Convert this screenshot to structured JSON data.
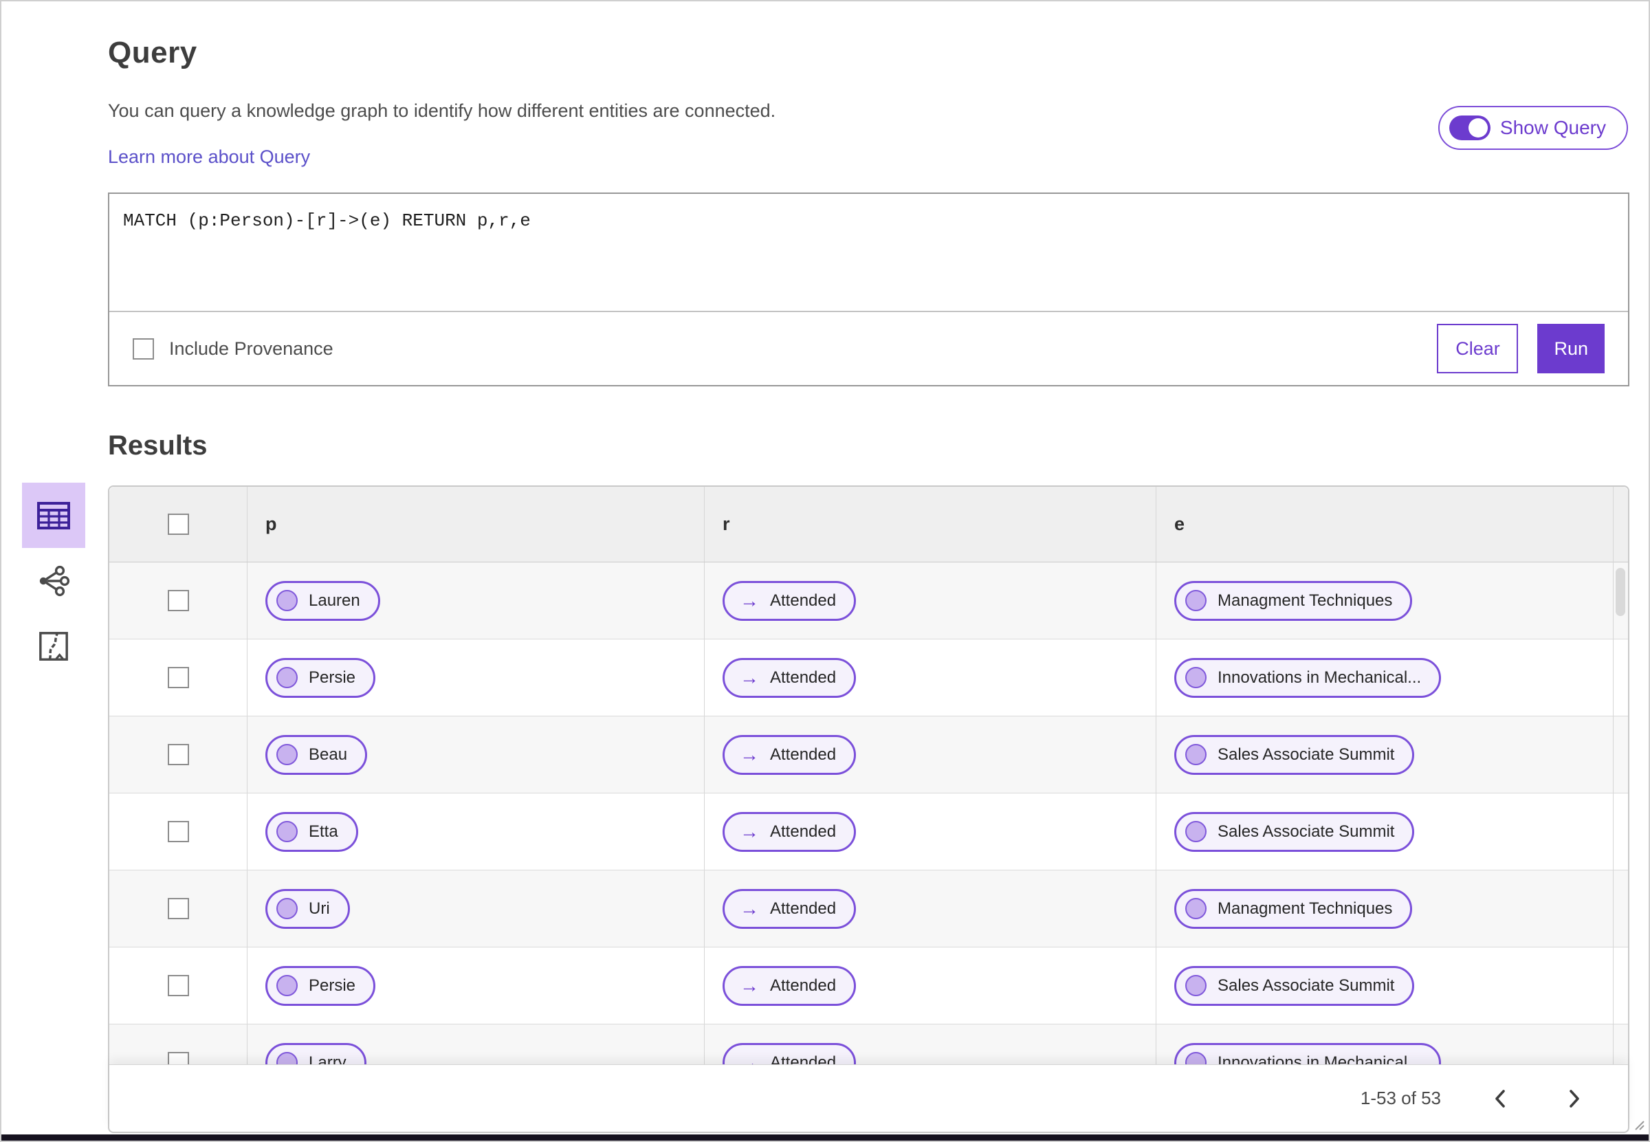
{
  "query": {
    "title": "Query",
    "description": "You can query a knowledge graph to identify how different entities are connected.",
    "learn_more_link": "Learn more about Query",
    "show_query_toggle": {
      "label": "Show Query",
      "state": "on"
    },
    "editor_text": "MATCH (p:Person)-[r]->(e) RETURN p,r,e",
    "include_provenance": {
      "label": "Include Provenance",
      "checked": false
    },
    "buttons": {
      "clear": "Clear",
      "run": "Run"
    }
  },
  "results": {
    "title": "Results",
    "view_switcher": [
      {
        "name": "table-view",
        "icon": "table-icon",
        "selected": true
      },
      {
        "name": "graph-view",
        "icon": "graph-icon",
        "selected": false
      },
      {
        "name": "map-view",
        "icon": "map-icon",
        "selected": false
      }
    ],
    "table": {
      "select_all_checked": false,
      "columns": [
        "p",
        "r",
        "e"
      ],
      "rows": [
        {
          "p": "Lauren",
          "r": "Attended",
          "e": "Managment Techniques"
        },
        {
          "p": "Persie",
          "r": "Attended",
          "e": "Innovations in Mechanical..."
        },
        {
          "p": "Beau",
          "r": "Attended",
          "e": "Sales Associate Summit"
        },
        {
          "p": "Etta",
          "r": "Attended",
          "e": "Sales Associate Summit"
        },
        {
          "p": "Uri",
          "r": "Attended",
          "e": "Managment Techniques"
        },
        {
          "p": "Persie",
          "r": "Attended",
          "e": "Sales Associate Summit"
        },
        {
          "p": "Larry",
          "r": "Attended",
          "e": "Innovations in Mechanical..."
        }
      ]
    },
    "pagination": {
      "range": "1-53 of 53"
    }
  },
  "colors": {
    "accent": "#6c3bce",
    "accent_dark_icon": "#3d2199",
    "pill_border": "#7b50da",
    "pill_background": "#f5f2fc",
    "pill_circle": "#c8b2ef",
    "selected_view_background": "#dcc8f7",
    "link": "#5b50c9"
  }
}
